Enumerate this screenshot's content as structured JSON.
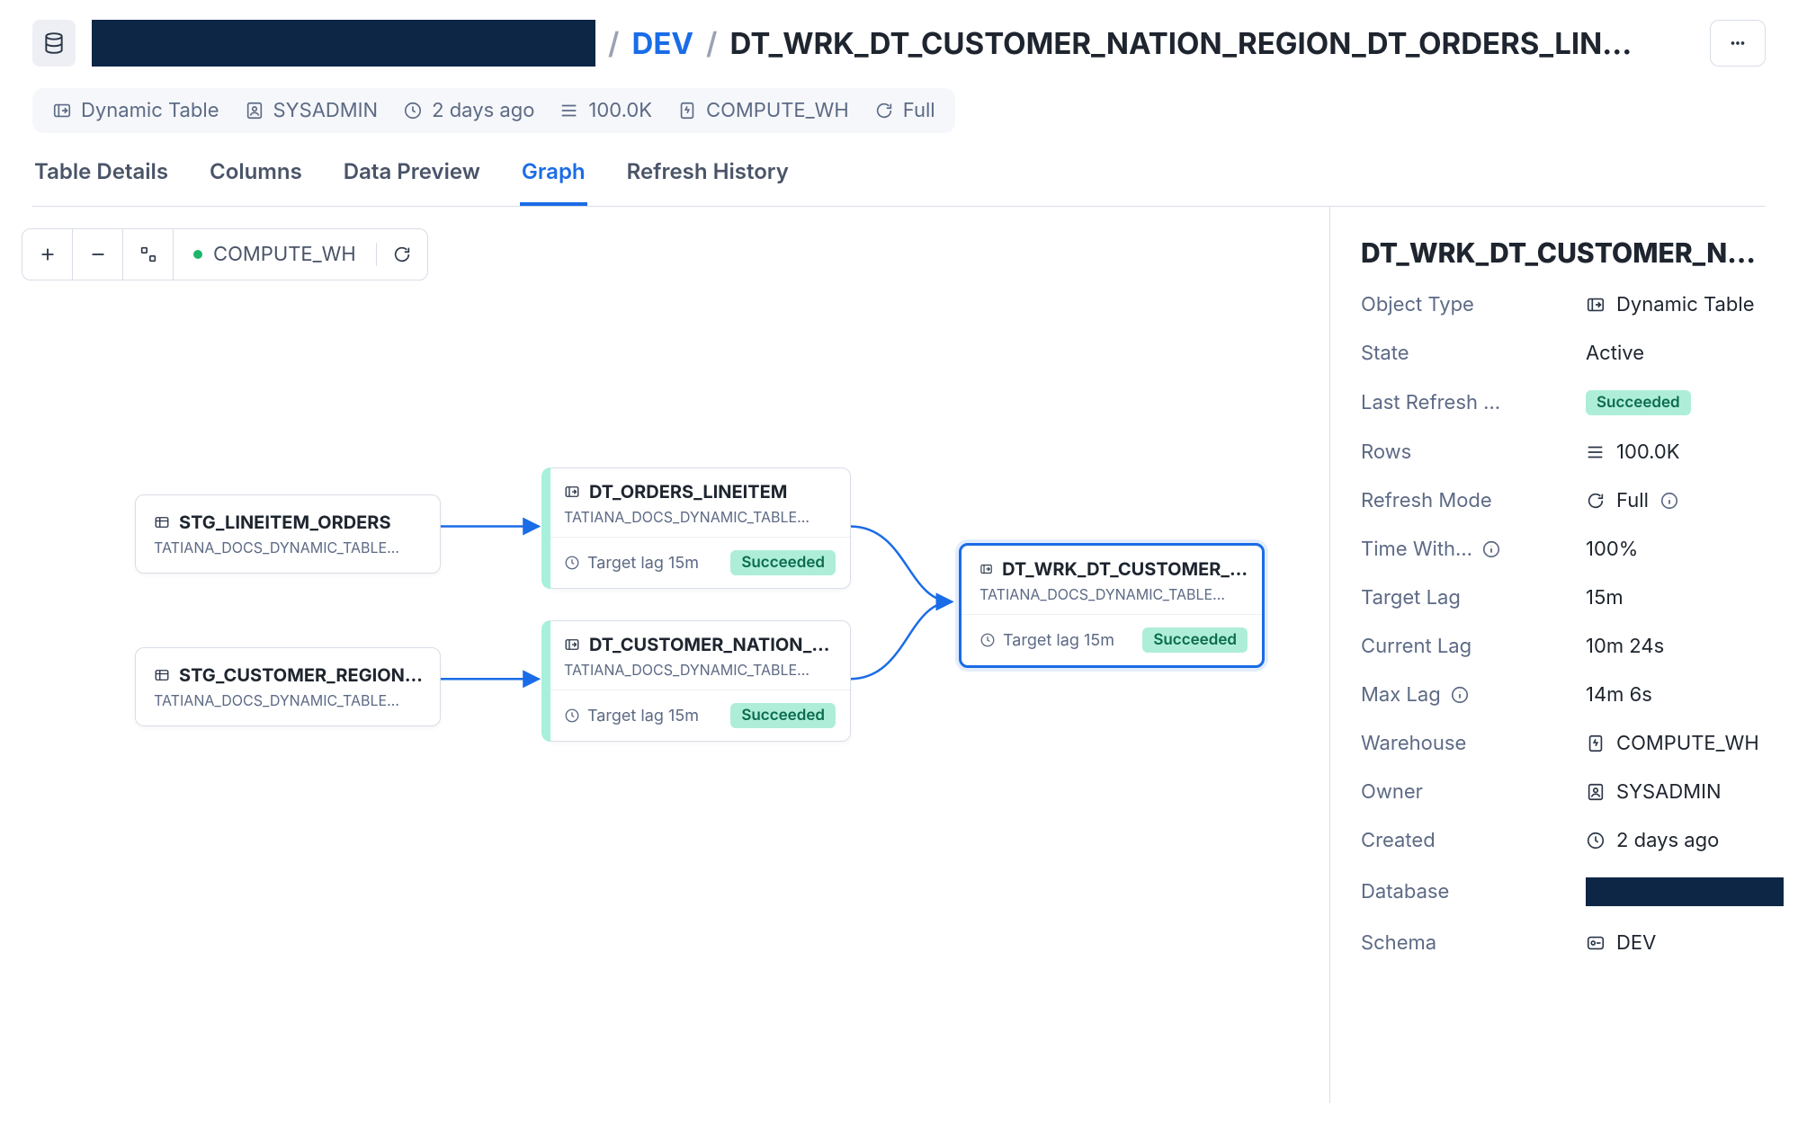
{
  "breadcrumb": {
    "schema_link": "DEV",
    "current": "DT_WRK_DT_CUSTOMER_NATION_REGION_DT_ORDERS_LIN…"
  },
  "meta": {
    "type": "Dynamic Table",
    "owner": "SYSADMIN",
    "created": "2 days ago",
    "rows": "100.0K",
    "warehouse": "COMPUTE_WH",
    "refresh_mode": "Full"
  },
  "tabs": {
    "details": "Table Details",
    "columns": "Columns",
    "preview": "Data Preview",
    "graph": "Graph",
    "history": "Refresh History"
  },
  "canvas": {
    "warehouse": "COMPUTE_WH",
    "nodes": {
      "stg1": {
        "title": "STG_LINEITEM_ORDERS",
        "sub": "TATIANA_DOCS_DYNAMIC_TABLE…"
      },
      "stg2": {
        "title": "STG_CUSTOMER_REGION…",
        "sub": "TATIANA_DOCS_DYNAMIC_TABLE…"
      },
      "dt1": {
        "title": "DT_ORDERS_LINEITEM",
        "sub": "TATIANA_DOCS_DYNAMIC_TABLE…",
        "lag": "Target lag 15m",
        "status": "Succeeded"
      },
      "dt2": {
        "title": "DT_CUSTOMER_NATION_…",
        "sub": "TATIANA_DOCS_DYNAMIC_TABLE…",
        "lag": "Target lag 15m",
        "status": "Succeeded"
      },
      "dt3": {
        "title": "DT_WRK_DT_CUSTOMER_…",
        "sub": "TATIANA_DOCS_DYNAMIC_TABLE…",
        "lag": "Target lag 15m",
        "status": "Succeeded"
      }
    }
  },
  "panel": {
    "title": "DT_WRK_DT_CUSTOMER_NATI…",
    "labels": {
      "object_type": "Object Type",
      "state": "State",
      "last_refresh": "Last Refresh …",
      "rows": "Rows",
      "refresh_mode": "Refresh Mode",
      "time_within": "Time With…",
      "target_lag": "Target Lag",
      "current_lag": "Current Lag",
      "max_lag": "Max Lag",
      "warehouse": "Warehouse",
      "owner": "Owner",
      "created": "Created",
      "database": "Database",
      "schema": "Schema"
    },
    "values": {
      "object_type": "Dynamic Table",
      "state": "Active",
      "last_refresh": "Succeeded",
      "rows": "100.0K",
      "refresh_mode": "Full",
      "time_within": "100%",
      "target_lag": "15m",
      "current_lag": "10m 24s",
      "max_lag": "14m 6s",
      "warehouse": "COMPUTE_WH",
      "owner": "SYSADMIN",
      "created": "2 days ago",
      "schema": "DEV"
    }
  }
}
